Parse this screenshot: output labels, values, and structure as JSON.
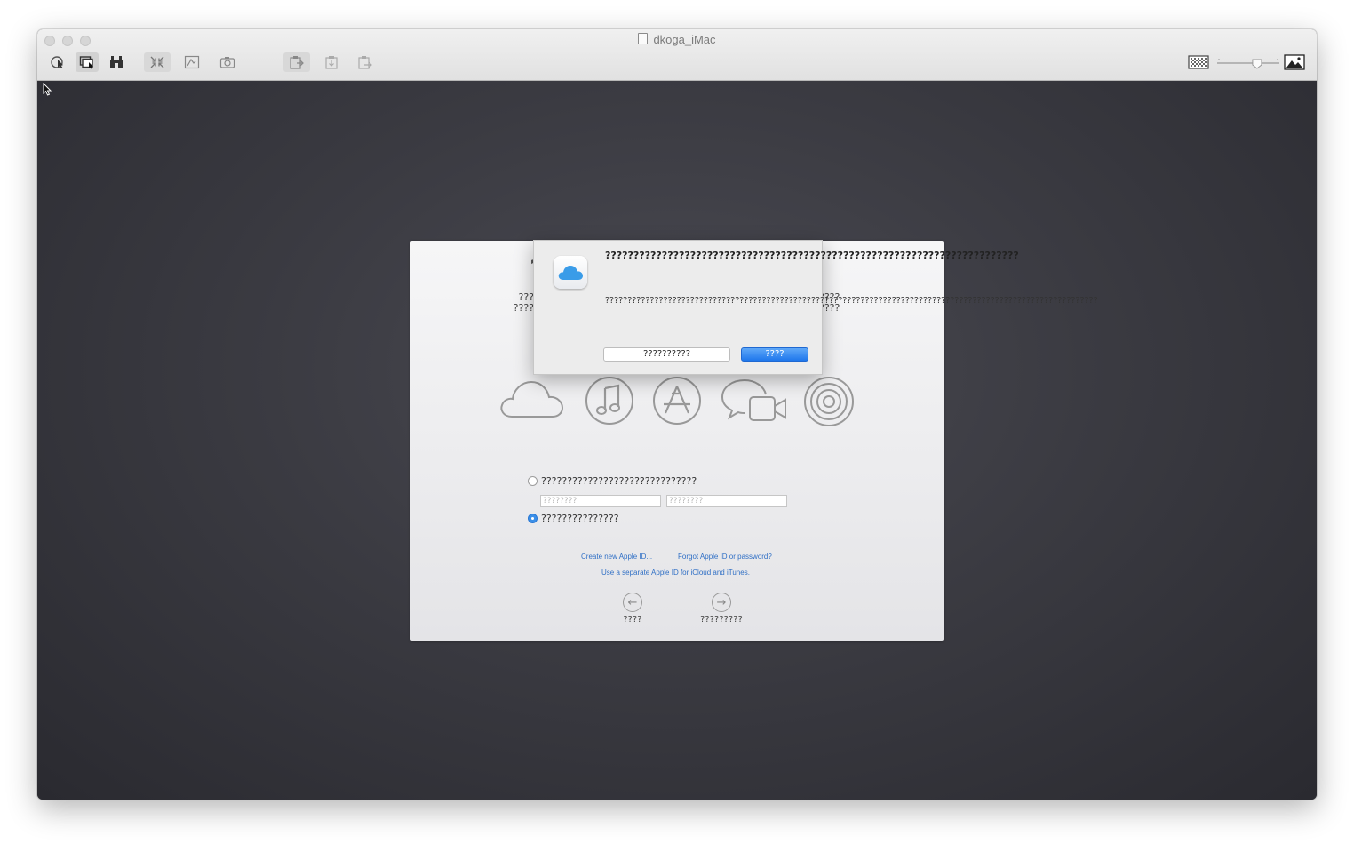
{
  "window": {
    "title": "dkoga_iMac"
  },
  "toolbar": {
    "tools": [
      "pointer-tool-icon",
      "window-select-icon",
      "binoculars-icon",
      "fit-screen-icon",
      "fullscreen-icon",
      "screenshot-icon",
      "share-clipboard-icon",
      "copy-clipboard-icon",
      "paste-clipboard-icon"
    ],
    "scale_slider_value": 0.65
  },
  "setup": {
    "header": "???? ?????????? ????",
    "subtitle_left_1": "???",
    "subtitle_left_2": "????",
    "subtitle_right_1": "????",
    "subtitle_right_2": "????",
    "service_icons": [
      "icloud-icon",
      "itunes-icon",
      "app-store-icon",
      "messages-facetime-icon",
      "game-center-icon"
    ],
    "option_signin_label": "??????????????????????????????",
    "apple_id_placeholder": "????????",
    "password_placeholder": "????????",
    "option_skip_label": "???????????????",
    "option_selected": "skip",
    "link_create": "Create new Apple ID...",
    "link_forgot": "Forgot Apple ID or password?",
    "link_separate": "Use a separate Apple ID for iCloud and iTunes.",
    "back_label": "????",
    "continue_label": "?????????"
  },
  "dialog": {
    "title": "?????????????????????????????????????????????????????????????????????????",
    "body": "??????????????????????????????????????????????????????????????????????????????????????????????????????????????",
    "secondary_button": "??????????",
    "primary_button": "????"
  },
  "colors": {
    "accent": "#3b8fe8",
    "link": "#2f6fc5",
    "desktop": "#3b3b42"
  }
}
